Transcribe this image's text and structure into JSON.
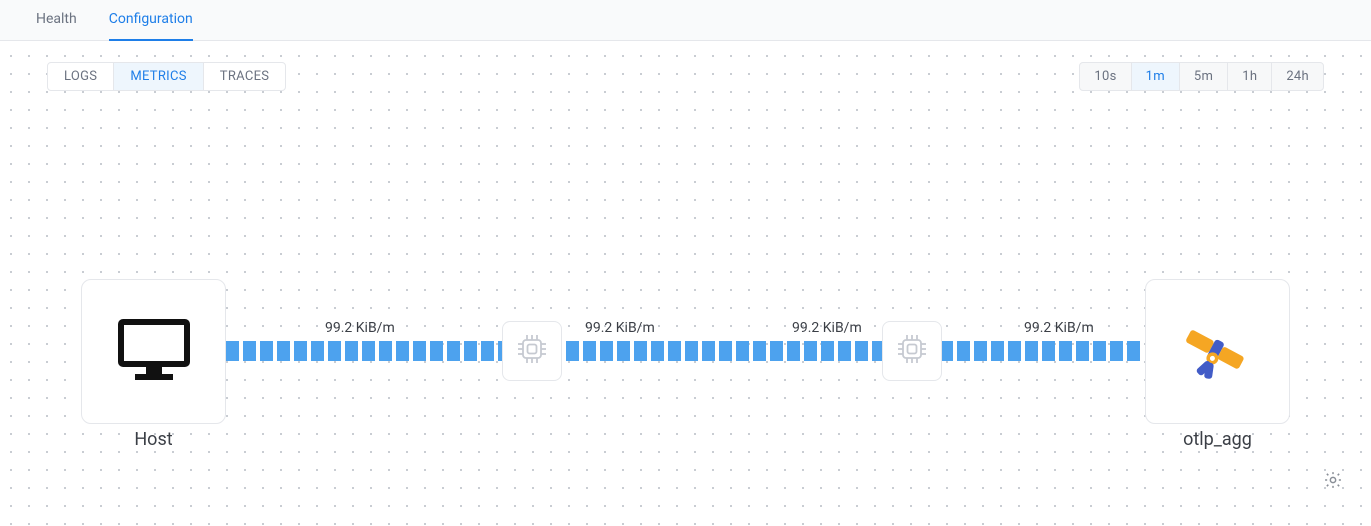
{
  "header": {
    "tabs": [
      {
        "label": "Health",
        "active": false
      },
      {
        "label": "Configuration",
        "active": true
      }
    ]
  },
  "data_tabs": [
    {
      "label": "LOGS",
      "active": false
    },
    {
      "label": "METRICS",
      "active": true
    },
    {
      "label": "TRACES",
      "active": false
    }
  ],
  "time_tabs": [
    {
      "label": "10s",
      "active": false
    },
    {
      "label": "1m",
      "active": true
    },
    {
      "label": "5m",
      "active": false
    },
    {
      "label": "1h",
      "active": false
    },
    {
      "label": "24h",
      "active": false
    }
  ],
  "pipeline": {
    "source": {
      "label": "Host",
      "icon": "monitor-icon"
    },
    "destination": {
      "label": "otlp_agg",
      "icon": "telescope-icon"
    },
    "processors": [
      {
        "icon": "cpu-icon"
      },
      {
        "icon": "cpu-icon"
      }
    ],
    "rates": [
      "99.2 KiB/m",
      "99.2 KiB/m",
      "99.2 KiB/m",
      "99.2 KiB/m"
    ]
  },
  "colors": {
    "accent": "#1e7ee8",
    "flow": "#4da2ee",
    "grid": "#c9cdd3"
  },
  "settings_icon": "gear-icon"
}
